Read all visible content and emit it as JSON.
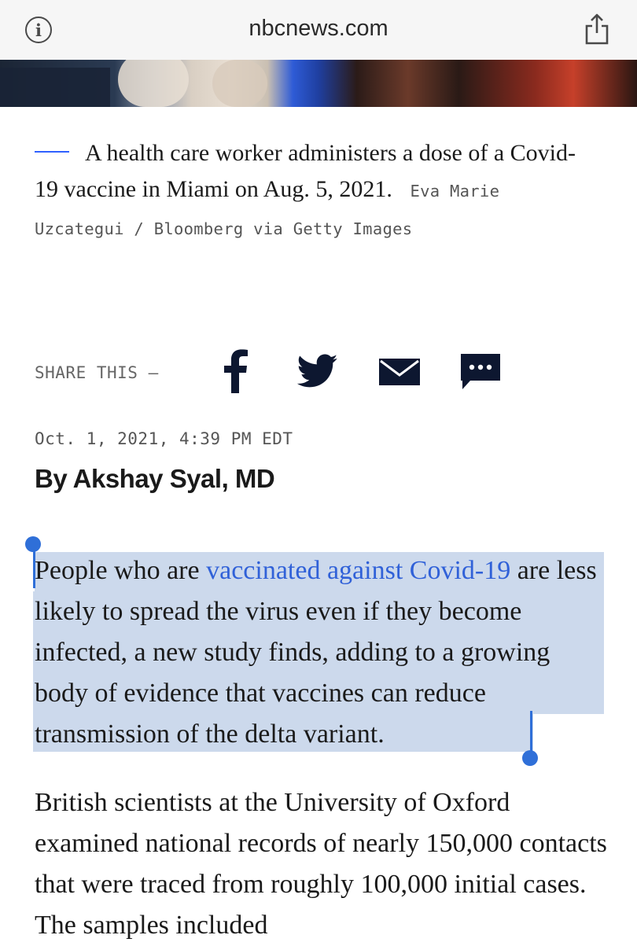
{
  "browser": {
    "url": "nbcnews.com",
    "info_icon": "info-icon",
    "share_icon": "share-icon"
  },
  "caption": {
    "text": "A health care worker administers a dose of a Covid-19 vaccine in Miami on Aug. 5, 2021.",
    "credit": "Eva Marie Uzcategui / Bloomberg via Getty Images"
  },
  "share": {
    "label": "SHARE THIS —",
    "icons": [
      "facebook-icon",
      "twitter-icon",
      "email-icon",
      "sms-icon"
    ]
  },
  "article": {
    "date": "Oct. 1, 2021, 4:39 PM EDT",
    "byline": "By Akshay Syal, MD",
    "p1_before": "People who are ",
    "p1_link": "vaccinated against Covid-19",
    "p1_after": " are less likely to spread the virus even if they become infected, a new study finds, adding to a growing body of evidence that vaccines can reduce transmission of the delta variant.",
    "p2": "British scientists at the University of Oxford examined national records of nearly 150,000 contacts that were traced from roughly 100,000 initial cases. The samples included"
  },
  "colors": {
    "accent": "#3061d8",
    "selection": "#ccd9ec",
    "selection_handle": "#2f6fd8"
  }
}
